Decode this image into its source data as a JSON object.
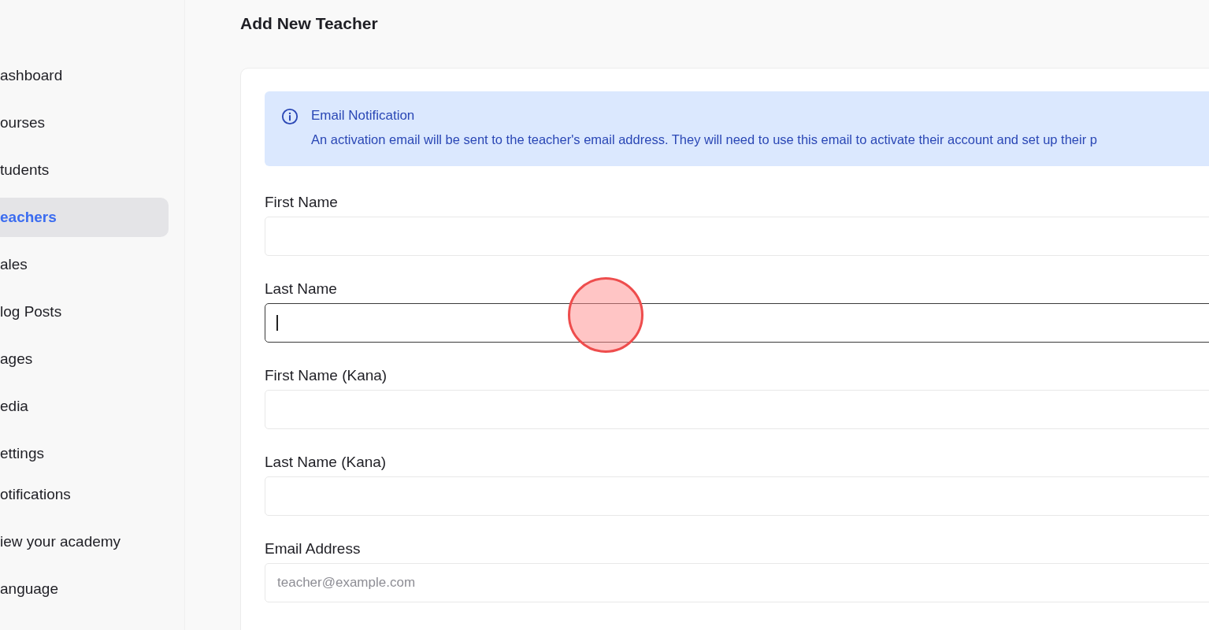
{
  "sidebar": {
    "items": [
      {
        "label": "ashboard",
        "selected": false
      },
      {
        "label": "ourses",
        "selected": false
      },
      {
        "label": "tudents",
        "selected": false
      },
      {
        "label": "eachers",
        "selected": true
      },
      {
        "label": "ales",
        "selected": false
      },
      {
        "label": "log Posts",
        "selected": false
      },
      {
        "label": "ages",
        "selected": false
      },
      {
        "label": "edia",
        "selected": false
      },
      {
        "label": "ettings",
        "selected": false
      },
      {
        "label": "otifications",
        "selected": false
      },
      {
        "label": "iew your academy",
        "selected": false
      },
      {
        "label": "anguage",
        "selected": false
      }
    ]
  },
  "page_title": "Add New Teacher",
  "notice": {
    "title": "Email Notification",
    "text": "An activation email will be sent to the teacher's email address. They will need to use this email to activate their account and set up their p"
  },
  "fields": [
    {
      "label": "First Name",
      "focused": false
    },
    {
      "label": "Last Name",
      "focused": true
    },
    {
      "label": "First Name (Kana)",
      "focused": false
    },
    {
      "label": "Last Name (Kana)",
      "focused": false
    },
    {
      "label": "Email Address",
      "placeholder": "teacher@example.com",
      "focused": false
    }
  ]
}
